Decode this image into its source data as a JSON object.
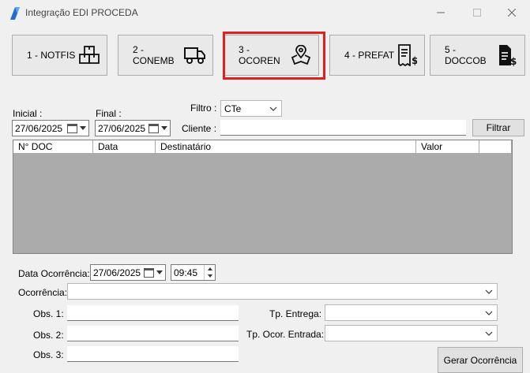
{
  "window": {
    "title": "Integração EDI PROCEDA"
  },
  "modules": [
    {
      "label": "1 - NOTFIS",
      "icon": "boxes-icon"
    },
    {
      "label": "2 - CONEMB",
      "icon": "truck-icon"
    },
    {
      "label": "3 - OCOREN",
      "icon": "map-pin-icon"
    },
    {
      "label": "4 - PREFAT",
      "icon": "invoice-icon"
    },
    {
      "label": "5 - DOCCOB",
      "icon": "billing-doc-icon"
    }
  ],
  "filters": {
    "inicial_label": "Inicial :",
    "inicial_value": "27/06/2025",
    "final_label": "Final :",
    "final_value": "27/06/2025",
    "filtro_label": "Filtro :",
    "filtro_value": "CTe",
    "cliente_label": "Cliente :",
    "cliente_value": "",
    "filtrar_label": "Filtrar"
  },
  "grid": {
    "columns": [
      "N° DOC",
      "Data",
      "Destinatário",
      "Valor",
      ""
    ]
  },
  "occurrence": {
    "data_label": "Data Ocorrência:",
    "data_value": "27/06/2025",
    "hora_value": "09:45",
    "ocorrencia_label": "Ocorrência:",
    "ocorrencia_value": "",
    "obs1_label": "Obs. 1:",
    "obs2_label": "Obs. 2:",
    "obs3_label": "Obs. 3:",
    "tp_entrega_label": "Tp. Entrega:",
    "tp_ocor_label": "Tp. Ocor. Entrada:",
    "gerar_label": "Gerar Ocorrência"
  }
}
